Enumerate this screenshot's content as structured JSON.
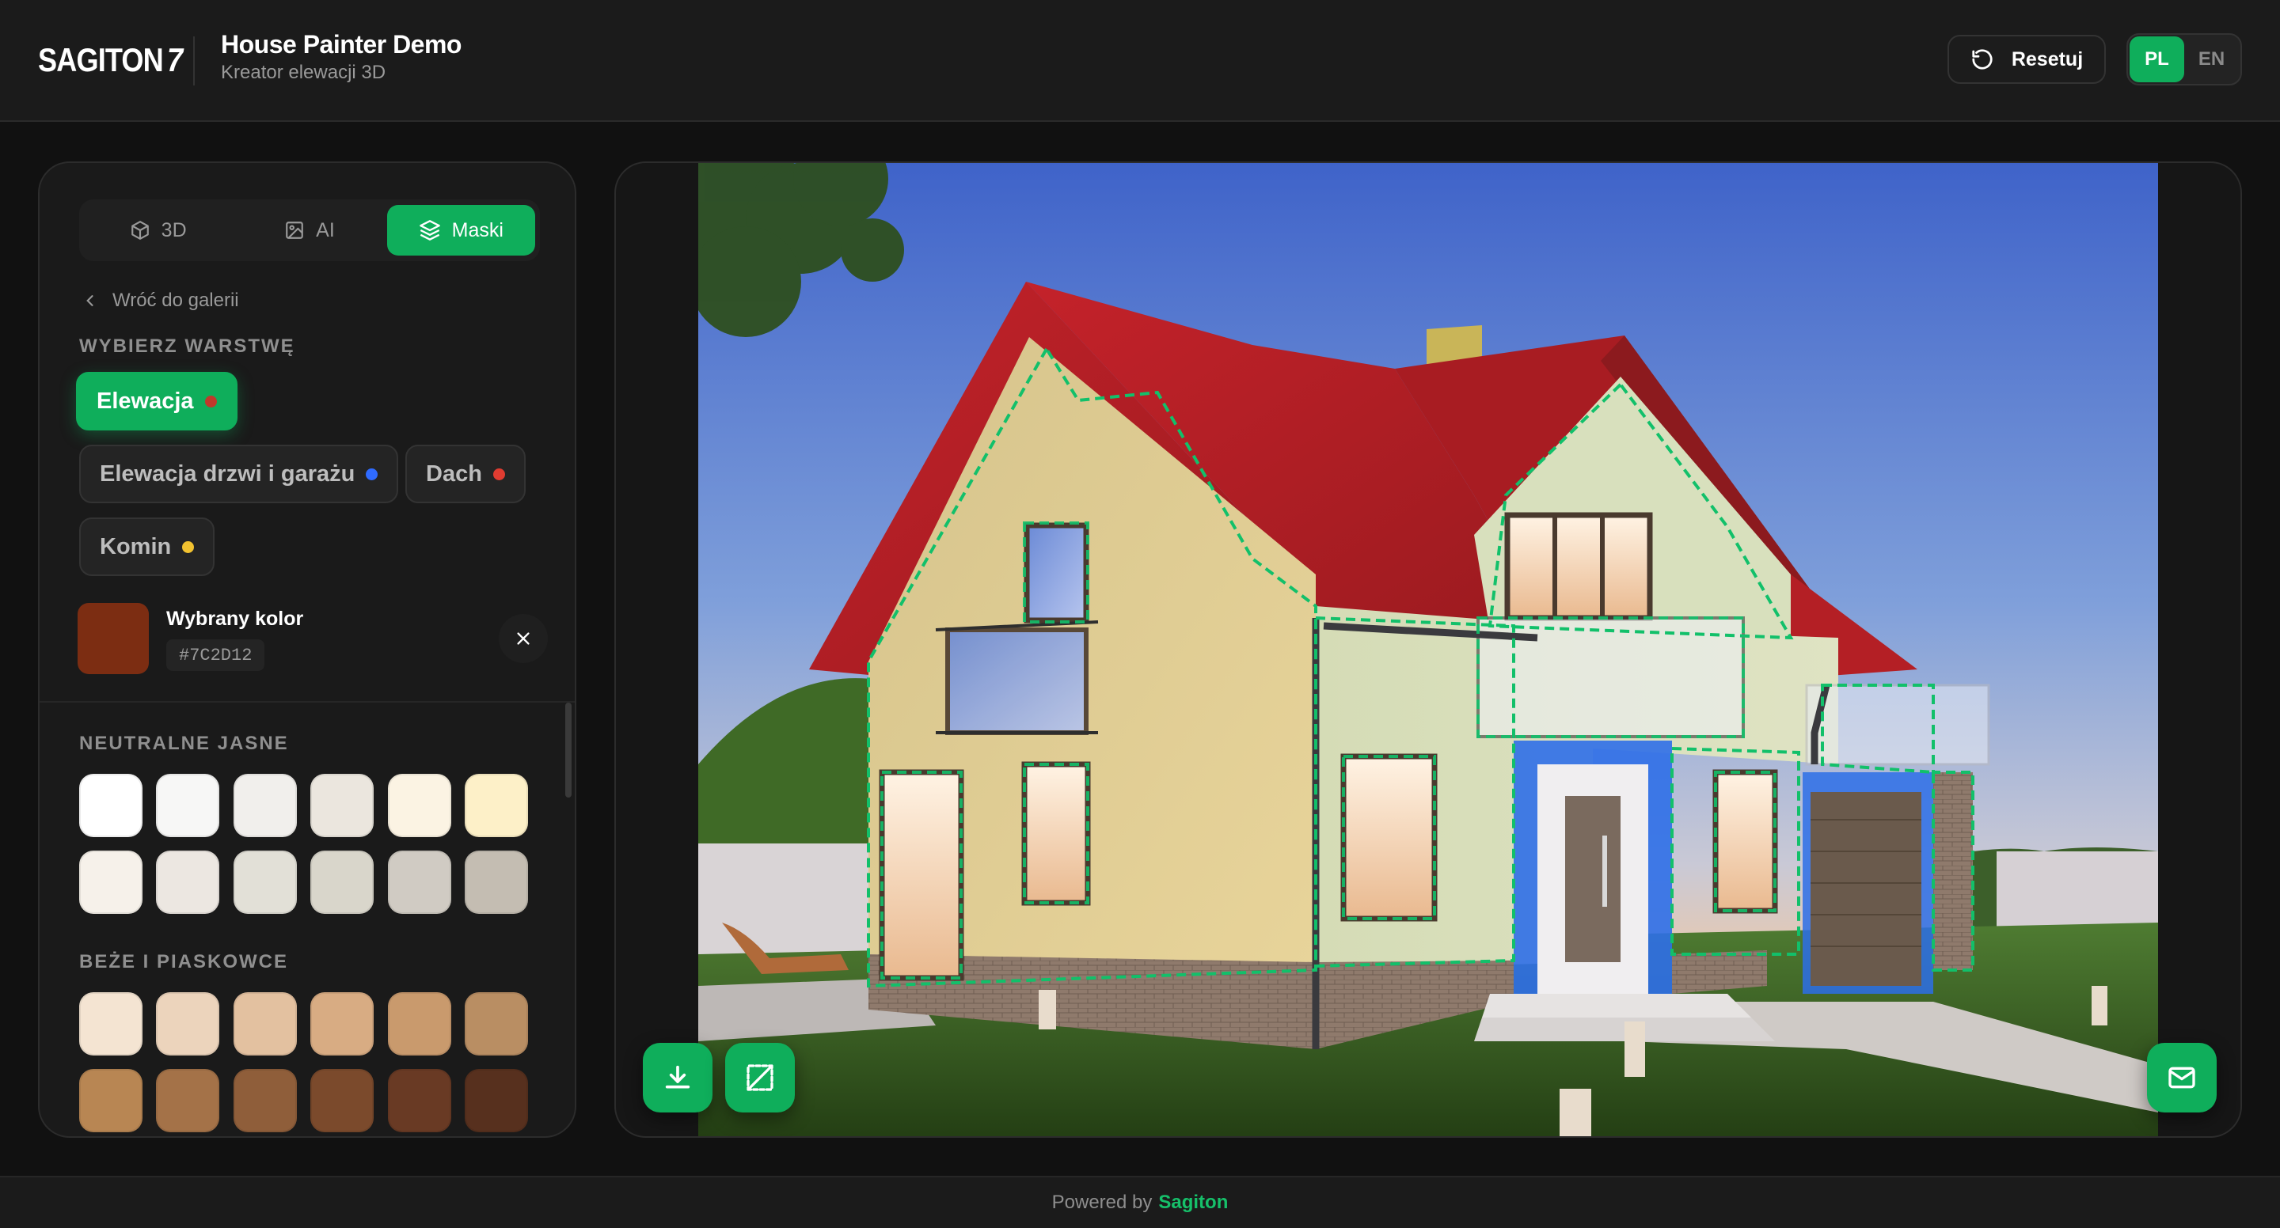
{
  "header": {
    "logo_text": "SAGITON",
    "logo_mark": "7",
    "title": "House Painter Demo",
    "subtitle": "Kreator elewacji 3D",
    "reset_label": "Resetuj",
    "languages": [
      {
        "code": "PL",
        "active": true
      },
      {
        "code": "EN",
        "active": false
      }
    ]
  },
  "panel": {
    "tabs": [
      {
        "label": "3D",
        "icon": "cube-icon",
        "active": false
      },
      {
        "label": "AI",
        "icon": "image-icon",
        "active": false
      },
      {
        "label": "Maski",
        "icon": "layers-icon",
        "active": true
      }
    ],
    "back_label": "Wróć do galerii",
    "layer_heading": "WYBIERZ WARSTWĘ",
    "layers": [
      {
        "label": "Elewacja",
        "color": "#c0392b",
        "active": true
      },
      {
        "label": "Elewacja drzwi i garażu",
        "color": "#2f6bff",
        "active": false
      },
      {
        "label": "Dach",
        "color": "#e03c31",
        "active": false
      },
      {
        "label": "Komin",
        "color": "#f2c230",
        "active": false
      }
    ],
    "selected_color": {
      "title": "Wybrany kolor",
      "hex": "#7C2D12"
    },
    "palettes": [
      {
        "name": "NEUTRALNE JASNE",
        "colors": [
          "#ffffff",
          "#f7f7f6",
          "#f1efec",
          "#ebe6de",
          "#fbf3e3",
          "#fdf0c8",
          "#f6f1ea",
          "#ece7e1",
          "#e2e0d7",
          "#d9d6cb",
          "#d0cbc3",
          "#c4bdb2"
        ]
      },
      {
        "name": "BEŻE I PIASKOWCE",
        "colors": [
          "#f4e4d2",
          "#ecd4bc",
          "#e3c1a0",
          "#d8ac83",
          "#c99a6d",
          "#b98e63",
          "#b88653",
          "#a47248",
          "#8f5e3a",
          "#7b4a2c",
          "#693a24",
          "#57301e"
        ]
      }
    ]
  },
  "viewer": {
    "actions": [
      {
        "name": "download-button",
        "icon": "download-icon"
      },
      {
        "name": "mask-toggle-button",
        "icon": "crop-icon"
      },
      {
        "name": "email-button",
        "icon": "mail-icon"
      }
    ]
  },
  "footer": {
    "prefix": "Powered by",
    "brand": "Sagiton"
  },
  "accent": "#0fae5b"
}
